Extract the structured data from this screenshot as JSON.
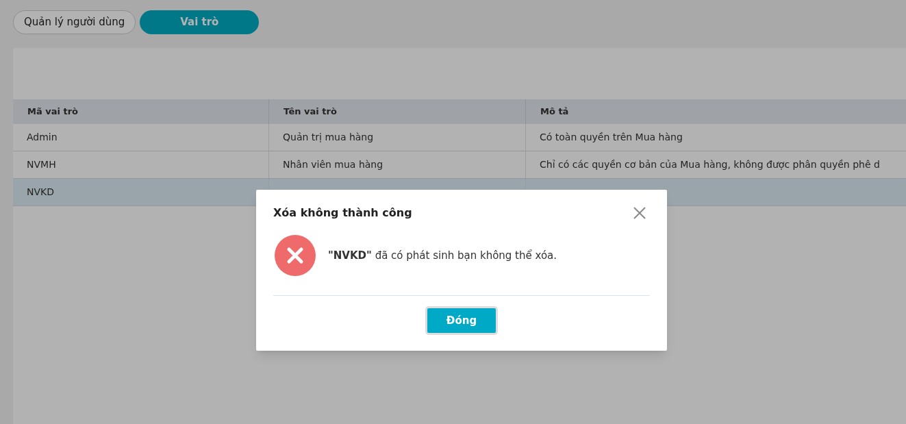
{
  "tabs": [
    {
      "label": "Quản lý người dùng",
      "selected": false
    },
    {
      "label": "Vai trò",
      "selected": true
    }
  ],
  "table": {
    "columns": [
      "Mã vai trò",
      "Tên vai trò",
      "Mô tả"
    ],
    "rows": [
      {
        "cells": [
          "Admin",
          "Quản trị mua hàng",
          "Có toàn quyền trên Mua hàng"
        ],
        "selected": false
      },
      {
        "cells": [
          "NVMH",
          "Nhân viên mua hàng",
          "Chỉ có các quyền cơ bản của Mua hàng, không được phân quyền phê d"
        ],
        "selected": false
      },
      {
        "cells": [
          "NVKD"
        ],
        "selected": true
      }
    ]
  },
  "dialog": {
    "title": "Xóa không thành công",
    "message": "**\"NVKD\"** đã có phát sinh bạn không thể xóa.",
    "button": "Đóng"
  }
}
